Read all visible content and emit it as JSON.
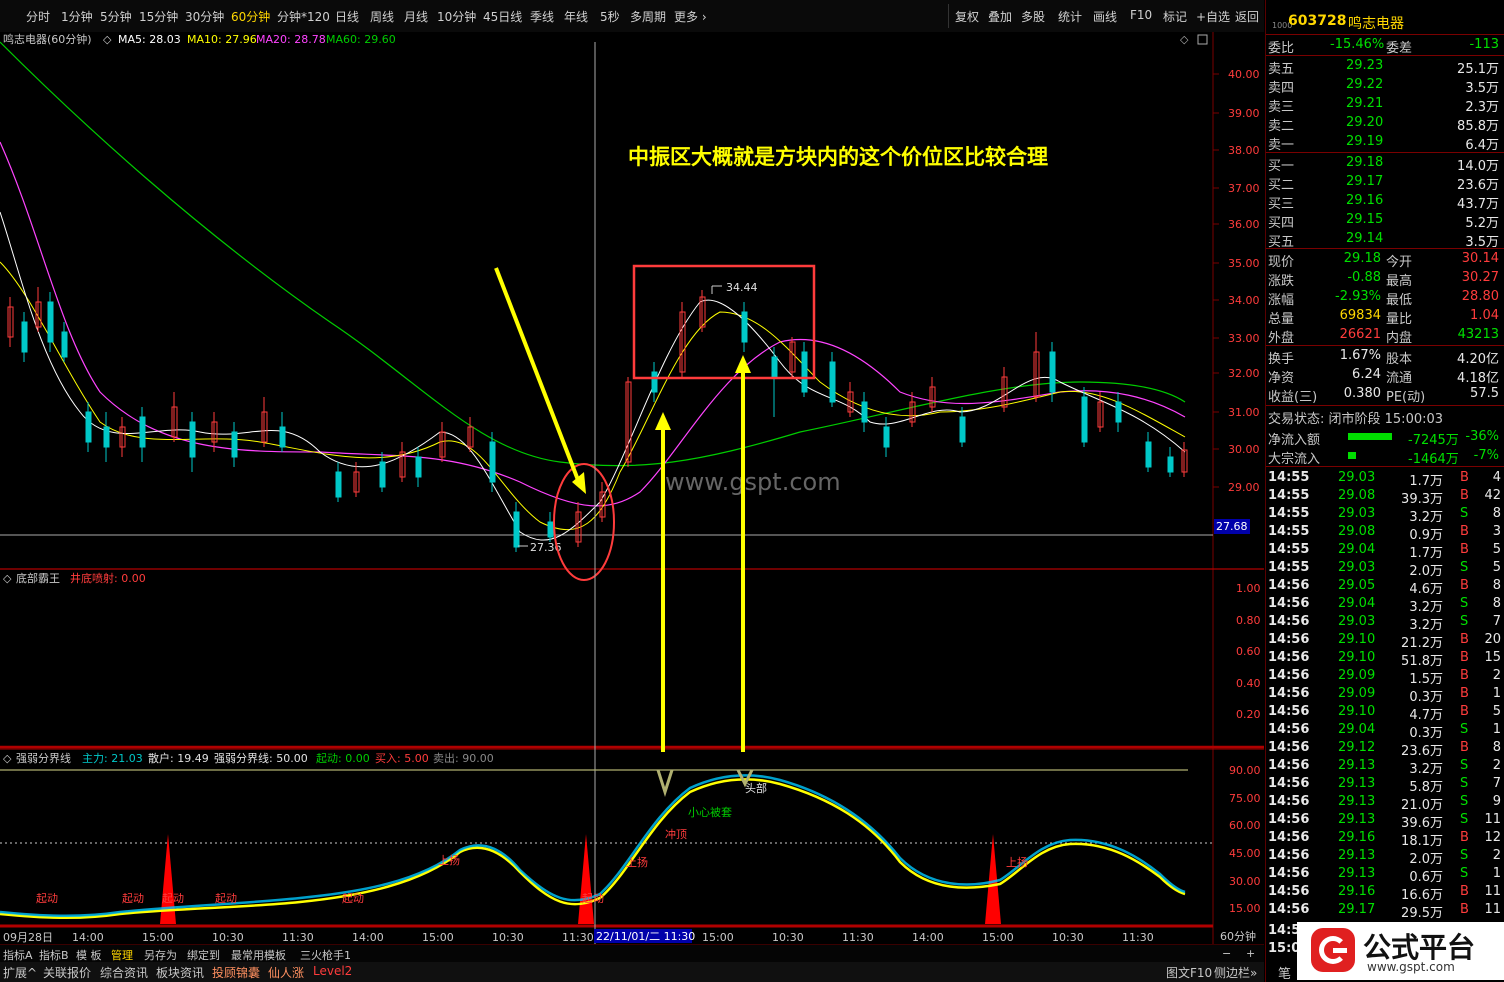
{
  "toolbar": {
    "periods": [
      "分时",
      "1分钟",
      "5分钟",
      "15分钟",
      "30分钟",
      "60分钟",
      "分钟*120",
      "日线",
      "周线",
      "月线",
      "10分钟",
      "45日线",
      "季线",
      "年线",
      "5秒",
      "多周期",
      "更多"
    ],
    "active_period": "60分钟",
    "tools": [
      "复权",
      "叠加",
      "多股",
      "统计",
      "画线",
      "F10",
      "标记",
      "+自选",
      "返回"
    ]
  },
  "main_chart": {
    "title": "鸣志电器(60分钟)",
    "ma5": "MA5: 28.03",
    "ma10": "MA10: 27.96",
    "ma20": "MA20: 28.78",
    "ma60": "MA60: 29.60",
    "annotation": "中振区大概就是方块内的这个价位区比较合理",
    "high_label": "34.44",
    "low_label": "27.36",
    "current_price_tag": "27.68",
    "watermark": "www.gspt.com",
    "y_ticks": [
      "40.00",
      "39.00",
      "38.00",
      "37.00",
      "36.00",
      "35.00",
      "34.00",
      "33.00",
      "32.00",
      "31.00",
      "30.00",
      "29.00"
    ]
  },
  "indicator1": {
    "name": "底部霸王",
    "param": "井底喷射: 0.00",
    "y_ticks": [
      "1.00",
      "0.80",
      "0.60",
      "0.40",
      "0.20"
    ]
  },
  "indicator2": {
    "name": "强弱分界线",
    "main": "主力: 21.03",
    "retail": "散户: 19.49",
    "line": "强弱分界线: 50.00",
    "start": "起动: 0.00",
    "buy": "买入: 5.00",
    "sell": "卖出: 90.00",
    "y_ticks": [
      "90.00",
      "75.00",
      "60.00",
      "45.00",
      "30.00",
      "15.00"
    ],
    "labels": {
      "qidong": "起动",
      "shangyang": "上扬",
      "chongding": "冲顶",
      "xiaoxin": "小心被套",
      "toubu": "头部"
    }
  },
  "x_axis": {
    "labels": [
      "09月28日",
      "14:00",
      "15:00",
      "10:30",
      "11:30",
      "14:00",
      "15:00",
      "10:30",
      "11:30",
      "15:00",
      "10:30",
      "11:30",
      "14:00",
      "15:00",
      "10:30",
      "11:30"
    ],
    "cursor_label": "22/11/01/二 11:30",
    "period": "60分钟"
  },
  "bottom_tabs": {
    "row1": [
      "指标A",
      "指标B",
      "模 板",
      "管理",
      "另存为",
      "绑定到",
      "最常用模板",
      "三火枪手1"
    ],
    "row1_selected": "管理",
    "row2": [
      "扩展^",
      "关联报价",
      "综合资讯",
      "板块资讯",
      "投顾锦囊",
      "仙人涨",
      "Level2"
    ],
    "row2_right": [
      "图文F10",
      "侧边栏»"
    ]
  },
  "quote": {
    "code": "603728",
    "name": "鸣志电器",
    "weibi_label": "委比",
    "weibi": "-15.46%",
    "weicha_label": "委差",
    "weicha": "-113",
    "asks": [
      {
        "label": "卖五",
        "price": "29.23",
        "vol": "25.1万"
      },
      {
        "label": "卖四",
        "price": "29.22",
        "vol": "3.5万"
      },
      {
        "label": "卖三",
        "price": "29.21",
        "vol": "2.3万"
      },
      {
        "label": "卖二",
        "price": "29.20",
        "vol": "85.8万"
      },
      {
        "label": "卖一",
        "price": "29.19",
        "vol": "6.4万"
      }
    ],
    "bids": [
      {
        "label": "买一",
        "price": "29.18",
        "vol": "14.0万"
      },
      {
        "label": "买二",
        "price": "29.17",
        "vol": "23.6万"
      },
      {
        "label": "买三",
        "price": "29.16",
        "vol": "43.7万"
      },
      {
        "label": "买四",
        "price": "29.15",
        "vol": "5.2万"
      },
      {
        "label": "买五",
        "price": "29.14",
        "vol": "3.5万"
      }
    ],
    "stats": [
      {
        "l1": "现价",
        "v1": "29.18",
        "l2": "今开",
        "v2": "30.14",
        "c1": "grn",
        "c2": "red"
      },
      {
        "l1": "涨跌",
        "v1": "-0.88",
        "l2": "最高",
        "v2": "30.27",
        "c1": "grn",
        "c2": "red"
      },
      {
        "l1": "涨幅",
        "v1": "-2.93%",
        "l2": "最低",
        "v2": "28.80",
        "c1": "grn",
        "c2": "red"
      },
      {
        "l1": "总量",
        "v1": "69834",
        "l2": "量比",
        "v2": "1.04",
        "c1": "yel",
        "c2": "red"
      },
      {
        "l1": "外盘",
        "v1": "26621",
        "l2": "内盘",
        "v2": "43213",
        "c1": "red",
        "c2": "grn"
      }
    ],
    "fund": [
      {
        "l1": "换手",
        "v1": "1.67%",
        "l2": "股本",
        "v2": "4.20亿"
      },
      {
        "l1": "净资",
        "v1": "6.24",
        "l2": "流通",
        "v2": "4.18亿"
      },
      {
        "l1": "收益(三)",
        "v1": "0.380",
        "l2": "PE(动)",
        "v2": "57.5"
      }
    ],
    "trade_status": "交易状态: 闭市阶段 15:00:03",
    "net_inflow": {
      "label": "净流入额",
      "value": "-7245万",
      "pct": "-36%"
    },
    "block_inflow": {
      "label": "大宗流入",
      "value": "-1464万",
      "pct": "-7%"
    },
    "ticks": [
      {
        "t": "14:55",
        "p": "29.03",
        "v": "1.7万",
        "d": "B",
        "n": "4"
      },
      {
        "t": "14:55",
        "p": "29.08",
        "v": "39.3万",
        "d": "B",
        "n": "42"
      },
      {
        "t": "14:55",
        "p": "29.03",
        "v": "3.2万",
        "d": "S",
        "n": "8"
      },
      {
        "t": "14:55",
        "p": "29.08",
        "v": "0.9万",
        "d": "B",
        "n": "3"
      },
      {
        "t": "14:55",
        "p": "29.04",
        "v": "1.7万",
        "d": "B",
        "n": "5"
      },
      {
        "t": "14:55",
        "p": "29.03",
        "v": "2.0万",
        "d": "S",
        "n": "5"
      },
      {
        "t": "14:56",
        "p": "29.05",
        "v": "4.6万",
        "d": "B",
        "n": "8"
      },
      {
        "t": "14:56",
        "p": "29.04",
        "v": "3.2万",
        "d": "S",
        "n": "8"
      },
      {
        "t": "14:56",
        "p": "29.03",
        "v": "3.2万",
        "d": "S",
        "n": "7"
      },
      {
        "t": "14:56",
        "p": "29.10",
        "v": "21.2万",
        "d": "B",
        "n": "20"
      },
      {
        "t": "14:56",
        "p": "29.10",
        "v": "51.8万",
        "d": "B",
        "n": "15"
      },
      {
        "t": "14:56",
        "p": "29.09",
        "v": "1.5万",
        "d": "B",
        "n": "2"
      },
      {
        "t": "14:56",
        "p": "29.09",
        "v": "0.3万",
        "d": "B",
        "n": "1"
      },
      {
        "t": "14:56",
        "p": "29.10",
        "v": "4.7万",
        "d": "B",
        "n": "5"
      },
      {
        "t": "14:56",
        "p": "29.04",
        "v": "0.3万",
        "d": "S",
        "n": "1"
      },
      {
        "t": "14:56",
        "p": "29.12",
        "v": "23.6万",
        "d": "B",
        "n": "8"
      },
      {
        "t": "14:56",
        "p": "29.13",
        "v": "3.2万",
        "d": "S",
        "n": "2"
      },
      {
        "t": "14:56",
        "p": "29.13",
        "v": "5.8万",
        "d": "S",
        "n": "7"
      },
      {
        "t": "14:56",
        "p": "29.13",
        "v": "21.0万",
        "d": "S",
        "n": "9"
      },
      {
        "t": "14:56",
        "p": "29.13",
        "v": "39.6万",
        "d": "S",
        "n": "11"
      },
      {
        "t": "14:56",
        "p": "29.16",
        "v": "18.1万",
        "d": "B",
        "n": "12"
      },
      {
        "t": "14:56",
        "p": "29.13",
        "v": "2.0万",
        "d": "S",
        "n": "2"
      },
      {
        "t": "14:56",
        "p": "29.13",
        "v": "0.6万",
        "d": "S",
        "n": "1"
      },
      {
        "t": "14:56",
        "p": "29.16",
        "v": "16.6万",
        "d": "B",
        "n": "11"
      },
      {
        "t": "14:56",
        "p": "29.17",
        "v": "29.5万",
        "d": "B",
        "n": "11"
      }
    ],
    "tick_tail_times": [
      "14:5",
      "15:0"
    ],
    "tick_tail_label": "笔"
  },
  "logo": {
    "text": "公式平台",
    "url": "www.gspt.com"
  },
  "colors": {
    "up": "#ff3c3c",
    "down": "#00c8c8",
    "ma5": "#ffffff",
    "ma10": "#ffff00",
    "ma20": "#ff44ff",
    "ma60": "#00cc00",
    "grid": "#7a0000"
  }
}
